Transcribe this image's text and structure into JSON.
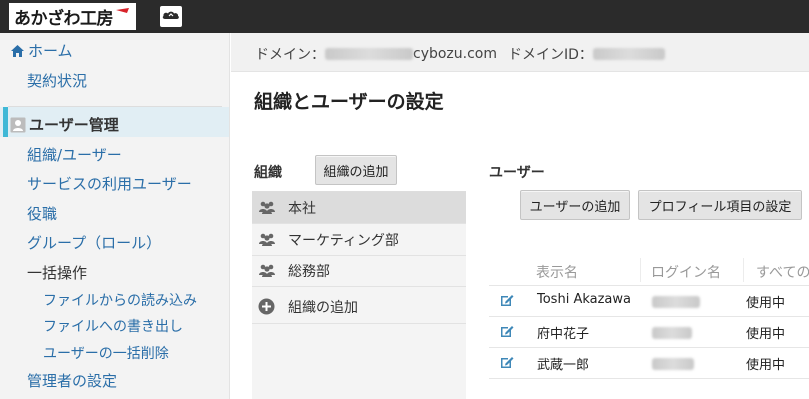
{
  "topbar": {
    "logo_text": "あかざわ工房",
    "app_icon": "cybozu-cloud-icon"
  },
  "sidebar": {
    "home": "ホーム",
    "contract": "契約状況",
    "user_admin": "ユーザー管理",
    "items": [
      {
        "label": "組織/ユーザー",
        "active": true
      },
      {
        "label": "サービスの利用ユーザー"
      },
      {
        "label": "役職"
      },
      {
        "label": "グループ（ロール）"
      }
    ],
    "bulk": "一括操作",
    "bulk_items": [
      {
        "label": "ファイルからの読み込み"
      },
      {
        "label": "ファイルへの書き出し"
      },
      {
        "label": "ユーザーの一括削除"
      }
    ],
    "admin_settings": "管理者の設定"
  },
  "domain_bar": {
    "domain_label": "ドメイン：",
    "domain_blurred": "dev-akazawa",
    "domain_suffix": "cybozu.com",
    "domain_id_label": "ドメインID：",
    "domain_id_blurred": "c310113"
  },
  "page": {
    "title": "組織とユーザーの設定"
  },
  "org_panel": {
    "label": "組織",
    "add_button": "組織の追加",
    "items": [
      {
        "label": "本社",
        "selected": true
      },
      {
        "label": "マーケティング部"
      },
      {
        "label": "総務部"
      }
    ],
    "add_item": "組織の追加"
  },
  "user_panel": {
    "label": "ユーザー",
    "add_user_button": "ユーザーの追加",
    "profile_button": "プロフィール項目の設定",
    "columns": [
      "表示名",
      "ログイン名",
      "すべての"
    ],
    "rows": [
      {
        "display_name": "Toshi Akazawa",
        "login_blurred": "akazawa",
        "status": "使用中"
      },
      {
        "display_name": "府中花子",
        "login_blurred": "hanako",
        "status": "使用中"
      },
      {
        "display_name": "武蔵一郎",
        "login_blurred": "musashi",
        "status": "使用中"
      }
    ]
  },
  "colors": {
    "link": "#2a6ea8",
    "active_bg": "#e1eef4",
    "active_bar": "#3fb8d6",
    "topbar": "#2b2b2b"
  }
}
